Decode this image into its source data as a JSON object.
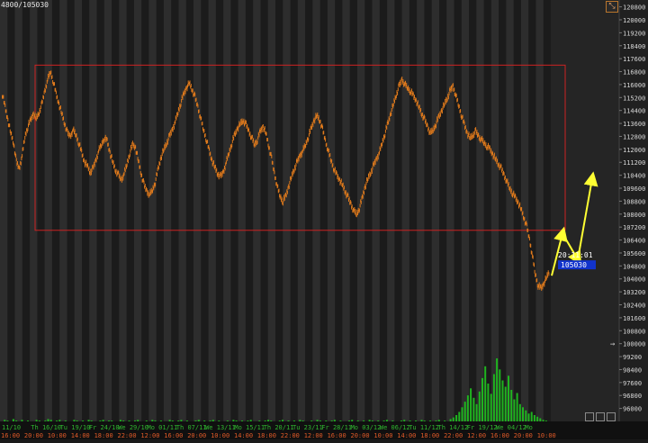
{
  "header": {
    "symbol": "4800/105030"
  },
  "price_tag": {
    "time": "20:11:01",
    "price": "105030"
  },
  "icons": {
    "corner": "resize-diagonal-icon",
    "bottom": [
      "grid-icon",
      "layout-icon",
      "zoom-icon"
    ]
  },
  "colors": {
    "background": "#1b1b1b",
    "stripe_dark": "#121212",
    "stripe_light": "#353535",
    "price": "#e07a1c",
    "volume": "#1fb41f",
    "box": "#cc2222",
    "arrow": "#ffff33",
    "tag": "#1133cc",
    "x_date": "#2fb52f",
    "x_time": "#e05a28"
  },
  "chart_data": {
    "type": "line",
    "title": "",
    "xlabel": "",
    "ylabel": "",
    "ylim": [
      95200,
      121000
    ],
    "y_ticks": [
      120800,
      120000,
      119200,
      118400,
      117600,
      116800,
      116000,
      115200,
      114400,
      113600,
      112800,
      112000,
      111200,
      110400,
      109600,
      108800,
      108000,
      107200,
      106400,
      105600,
      104800,
      104000,
      103200,
      102400,
      101600,
      100800,
      100000,
      99200,
      98400,
      97600,
      96800,
      96000
    ],
    "x_date_labels": [
      "11/10",
      "Th 16/10",
      "Tu 19/10",
      "Fr 24/10",
      "We 29/10",
      "Mo 01/11",
      "Th 07/11",
      "We 13/11",
      "Mo 15/11",
      "Th 20/11",
      "Tu 23/11",
      "Fr 28/11",
      "Mo 03/12",
      "We 06/12",
      "Tu 11/12",
      "Th 14/12",
      "Fr 19/12",
      "We 04/12",
      "Mo"
    ],
    "x_time_labels": [
      "16:00",
      "20:00",
      "10:00",
      "14:00",
      "18:00",
      "22:00",
      "12:00",
      "16:00",
      "20:00",
      "10:00",
      "14:00",
      "18:00",
      "22:00",
      "12:00",
      "16:00",
      "20:00",
      "10:00",
      "14:00",
      "18:00",
      "22:00",
      "12:00",
      "16:00",
      "20:00",
      "10:00"
    ],
    "series": [
      {
        "values": [
          115400,
          114600,
          113800,
          113000,
          112400,
          111200,
          110800,
          111600,
          112800,
          113400,
          113800,
          114200,
          113900,
          114300,
          114800,
          115600,
          116300,
          116800,
          116200,
          115400,
          114800,
          114200,
          113600,
          113000,
          112800,
          113200,
          112900,
          112400,
          111800,
          111200,
          111000,
          110600,
          110800,
          111300,
          111900,
          112300,
          112700,
          112500,
          111800,
          111200,
          110700,
          110400,
          110100,
          110500,
          111100,
          111800,
          112300,
          112100,
          111300,
          110500,
          109800,
          109400,
          109200,
          109500,
          110000,
          110800,
          111500,
          112000,
          112400,
          112800,
          113200,
          113700,
          114300,
          114900,
          115400,
          115800,
          116100,
          115700,
          115200,
          114600,
          113900,
          113200,
          112600,
          111900,
          111300,
          110900,
          110500,
          110300,
          110600,
          111200,
          111800,
          112400,
          112900,
          113300,
          113600,
          113800,
          113500,
          113100,
          112700,
          112300,
          112600,
          113100,
          113400,
          113000,
          112200,
          111400,
          110500,
          109700,
          109100,
          108800,
          109100,
          109700,
          110300,
          110800,
          111200,
          111600,
          111900,
          112300,
          112800,
          113300,
          113800,
          114100,
          113800,
          113200,
          112500,
          111900,
          111300,
          110800,
          110400,
          110100,
          109800,
          109400,
          109000,
          108600,
          108200,
          108000,
          108400,
          109000,
          109700,
          110200,
          110600,
          111000,
          111400,
          111800,
          112400,
          113000,
          113600,
          114200,
          114800,
          115400,
          115900,
          116300,
          116000,
          115800,
          115600,
          115300,
          115000,
          114600,
          114200,
          113800,
          113400,
          113000,
          113200,
          113600,
          114000,
          114400,
          114800,
          115200,
          115600,
          115900,
          115300,
          114700,
          114100,
          113500,
          113000,
          112700,
          112900,
          113100,
          112800,
          112600,
          112400,
          112200,
          112000,
          111700,
          111400,
          111100,
          110800,
          110400,
          110000,
          109600,
          109300,
          109000,
          108700,
          108300,
          107800,
          107200,
          106400,
          105400,
          104300,
          103600,
          103400,
          103700,
          104100,
          104500
        ]
      },
      {
        "name": "volume",
        "values": [
          0,
          2,
          1,
          0,
          3,
          1,
          0,
          2,
          0,
          1,
          0,
          0,
          2,
          1,
          0,
          1,
          3,
          2,
          0,
          1,
          2,
          0,
          1,
          0,
          0,
          2,
          1,
          0,
          1,
          0,
          2,
          1,
          0,
          0,
          1,
          2,
          0,
          1,
          1,
          0,
          0,
          2,
          1,
          0,
          1,
          0,
          1,
          2,
          0,
          0,
          1,
          0,
          2,
          1,
          0,
          1,
          0,
          0,
          2,
          1,
          0,
          1,
          2,
          0,
          1,
          0,
          0,
          1,
          2,
          0,
          1,
          0,
          1,
          2,
          0,
          1,
          0,
          0,
          1,
          0,
          2,
          1,
          0,
          1,
          0,
          1,
          2,
          0,
          0,
          1,
          0,
          1,
          2,
          1,
          0,
          0,
          1,
          2,
          0,
          1,
          0,
          1,
          0,
          2,
          1,
          0,
          0,
          1,
          0,
          2,
          1,
          0,
          1,
          0,
          1,
          2,
          0,
          1,
          0,
          0,
          1,
          2,
          0,
          1,
          0,
          1,
          0,
          2,
          1,
          0,
          1,
          0,
          1,
          2,
          0,
          1,
          0,
          0,
          1,
          2,
          0,
          1,
          0,
          1,
          0,
          2,
          1,
          0,
          1,
          0,
          1,
          2,
          0,
          1,
          0,
          3,
          5,
          8,
          12,
          18,
          25,
          33,
          42,
          30,
          22,
          38,
          55,
          70,
          48,
          35,
          60,
          80,
          66,
          52,
          44,
          58,
          40,
          28,
          36,
          22,
          18,
          14,
          10,
          12,
          8,
          6,
          4,
          2,
          1,
          0
        ]
      }
    ],
    "annotations": [
      {
        "type": "rectangle",
        "color": "red",
        "y": [
          107000,
          117200
        ]
      },
      {
        "type": "arrow",
        "color": "yellow",
        "from_price": 104200,
        "to_price": 106800
      },
      {
        "type": "arrow",
        "color": "yellow",
        "from_price": 106800,
        "to_price": 105200
      },
      {
        "type": "arrow",
        "color": "yellow",
        "from_price": 105200,
        "to_price": 110200
      }
    ]
  }
}
